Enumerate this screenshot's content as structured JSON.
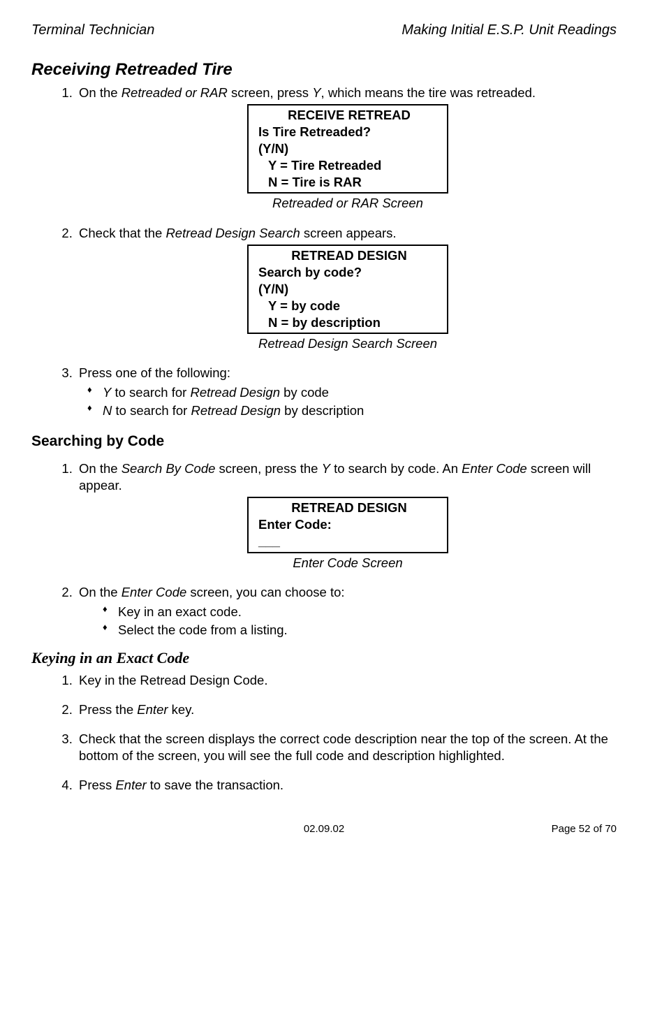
{
  "header": {
    "left": "Terminal Technician",
    "right": "Making Initial E.S.P. Unit Readings"
  },
  "section_title": "Receiving Retreaded Tire",
  "receiving": {
    "step1": {
      "prefix": "On the ",
      "screen_name": "Retreaded or RAR",
      "mid": " screen, press ",
      "key": "Y",
      "suffix": ", which means the tire was retreaded."
    },
    "screen1": {
      "title": "RECEIVE RETREAD",
      "line1": "Is Tire Retreaded?",
      "line2": "(Y/N)",
      "optY": "Y = Tire Retreaded",
      "optN": "N = Tire is RAR",
      "caption": "Retreaded or RAR Screen"
    },
    "step2": {
      "prefix": "Check that the ",
      "screen_name": "Retread Design Search",
      "suffix": " screen appears."
    },
    "screen2": {
      "title": "RETREAD DESIGN",
      "line1": "Search by code?",
      "line2": "(Y/N)",
      "optY": "Y = by code",
      "optN": "N = by description",
      "caption": "Retread Design Search Screen"
    },
    "step3": {
      "intro": "Press one of the following:",
      "bullet1": {
        "key": "Y",
        "mid": " to search for ",
        "design": "Retread Design",
        "suffix": " by code"
      },
      "bullet2": {
        "key": "N",
        "mid": " to search for ",
        "design": "Retread Design",
        "suffix": " by description"
      }
    }
  },
  "searching_title": "Searching by Code",
  "searching": {
    "step1": {
      "prefix": "On the ",
      "screen_name": "Search By Code",
      "mid1": " screen, press the ",
      "key": "Y",
      "mid2": " to search by code.  An ",
      "screen_name2": "Enter Code",
      "suffix": " screen will appear."
    },
    "screen1": {
      "title": "RETREAD DESIGN",
      "line1": "Enter Code:",
      "blank": "___",
      "caption": "Enter Code Screen"
    },
    "step2": {
      "prefix": "On the ",
      "screen_name": "Enter Code",
      "suffix": " screen, you can choose to:",
      "bullet1": "Key in an exact code.",
      "bullet2": "Select the code from a listing."
    }
  },
  "keying_title": "Keying in an Exact Code",
  "keying": {
    "step1": "Key in the Retread Design Code.",
    "step2": {
      "prefix": "Press the ",
      "key": "Enter",
      "suffix": " key."
    },
    "step3": "Check that the screen displays the correct code description near the top of the screen.  At the bottom of the screen, you will see the full code and description highlighted.",
    "step4": {
      "prefix": "Press ",
      "key": "Enter",
      "suffix": " to save the transaction."
    }
  },
  "footer": {
    "date": "02.09.02",
    "page": "Page 52 of 70"
  }
}
